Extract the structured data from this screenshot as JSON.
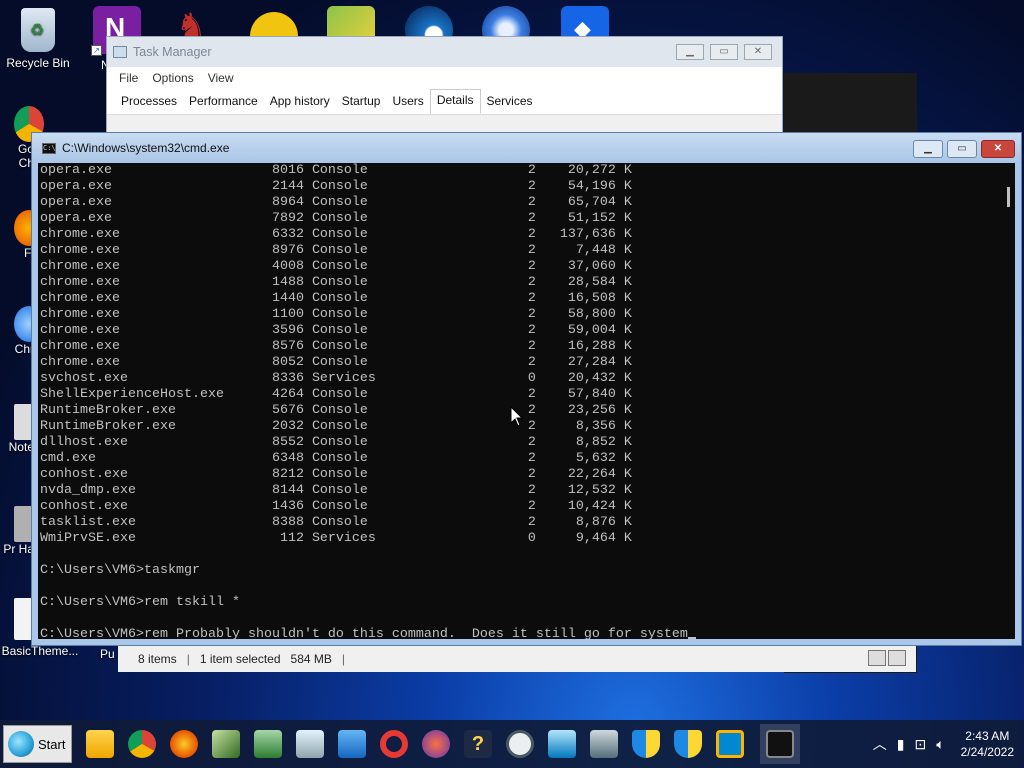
{
  "desktop": {
    "recycle_bin_label": "Recycle Bin",
    "stubs": [
      "Go Ch",
      "Fi",
      "Chr",
      "Note",
      "Pr Ha"
    ],
    "basic_theme_label": "BasicTheme...",
    "pu_label": "Pu",
    "n_label": "N"
  },
  "task_manager": {
    "title": "Task Manager",
    "menu": [
      "File",
      "Options",
      "View"
    ],
    "tabs": [
      "Processes",
      "Performance",
      "App history",
      "Startup",
      "Users",
      "Details",
      "Services"
    ],
    "active_tab": "Details",
    "status": {
      "items": "8 items",
      "selected": "1 item selected",
      "size": "584 MB",
      "sep": "|"
    }
  },
  "cmd": {
    "title": "C:\\Windows\\system32\\cmd.exe",
    "processes": [
      {
        "name": "opera.exe",
        "pid": "8016",
        "session": "Console",
        "num": "2",
        "mem": "20,272 K"
      },
      {
        "name": "opera.exe",
        "pid": "2144",
        "session": "Console",
        "num": "2",
        "mem": "54,196 K"
      },
      {
        "name": "opera.exe",
        "pid": "8964",
        "session": "Console",
        "num": "2",
        "mem": "65,704 K"
      },
      {
        "name": "opera.exe",
        "pid": "7892",
        "session": "Console",
        "num": "2",
        "mem": "51,152 K"
      },
      {
        "name": "chrome.exe",
        "pid": "6332",
        "session": "Console",
        "num": "2",
        "mem": "137,636 K"
      },
      {
        "name": "chrome.exe",
        "pid": "8976",
        "session": "Console",
        "num": "2",
        "mem": "7,448 K"
      },
      {
        "name": "chrome.exe",
        "pid": "4008",
        "session": "Console",
        "num": "2",
        "mem": "37,060 K"
      },
      {
        "name": "chrome.exe",
        "pid": "1488",
        "session": "Console",
        "num": "2",
        "mem": "28,584 K"
      },
      {
        "name": "chrome.exe",
        "pid": "1440",
        "session": "Console",
        "num": "2",
        "mem": "16,508 K"
      },
      {
        "name": "chrome.exe",
        "pid": "1100",
        "session": "Console",
        "num": "2",
        "mem": "58,800 K"
      },
      {
        "name": "chrome.exe",
        "pid": "3596",
        "session": "Console",
        "num": "2",
        "mem": "59,004 K"
      },
      {
        "name": "chrome.exe",
        "pid": "8576",
        "session": "Console",
        "num": "2",
        "mem": "16,288 K"
      },
      {
        "name": "chrome.exe",
        "pid": "8052",
        "session": "Console",
        "num": "2",
        "mem": "27,284 K"
      },
      {
        "name": "svchost.exe",
        "pid": "8336",
        "session": "Services",
        "num": "0",
        "mem": "20,432 K"
      },
      {
        "name": "ShellExperienceHost.exe",
        "pid": "4264",
        "session": "Console",
        "num": "2",
        "mem": "57,840 K"
      },
      {
        "name": "RuntimeBroker.exe",
        "pid": "5676",
        "session": "Console",
        "num": "2",
        "mem": "23,256 K"
      },
      {
        "name": "RuntimeBroker.exe",
        "pid": "2032",
        "session": "Console",
        "num": "2",
        "mem": "8,356 K"
      },
      {
        "name": "dllhost.exe",
        "pid": "8552",
        "session": "Console",
        "num": "2",
        "mem": "8,852 K"
      },
      {
        "name": "cmd.exe",
        "pid": "6348",
        "session": "Console",
        "num": "2",
        "mem": "5,632 K"
      },
      {
        "name": "conhost.exe",
        "pid": "8212",
        "session": "Console",
        "num": "2",
        "mem": "22,264 K"
      },
      {
        "name": "nvda_dmp.exe",
        "pid": "8144",
        "session": "Console",
        "num": "2",
        "mem": "12,532 K"
      },
      {
        "name": "conhost.exe",
        "pid": "1436",
        "session": "Console",
        "num": "2",
        "mem": "10,424 K"
      },
      {
        "name": "tasklist.exe",
        "pid": "8388",
        "session": "Console",
        "num": "2",
        "mem": "8,876 K"
      },
      {
        "name": "WmiPrvSE.exe",
        "pid": "112",
        "session": "Services",
        "num": "0",
        "mem": "9,464 K"
      }
    ],
    "commands": [
      "C:\\Users\\VM6>taskmgr",
      "C:\\Users\\VM6>rem tskill *",
      "C:\\Users\\VM6>rem Probably shouldn't do this command.  Does it still go for system"
    ]
  },
  "taskbar": {
    "start_label": "Start",
    "time": "2:43 AM",
    "date": "2/24/2022",
    "apps": [
      "file-explorer-icon",
      "chrome-icon",
      "firefox-icon",
      "notepad-plus-icon",
      "sysinfo-icon",
      "notepad-icon",
      "media-player-icon",
      "opera-icon",
      "nvda-icon",
      "help-icon",
      "clock-app-icon",
      "remote-desktop-icon",
      "network-icon",
      "defender-icon",
      "security-icon",
      "window-icon",
      "cmd-icon"
    ]
  },
  "colors": {
    "console_bg": "#0c0c0c",
    "console_text": "#c0c0c0",
    "cmd_close": "#c9463d"
  }
}
